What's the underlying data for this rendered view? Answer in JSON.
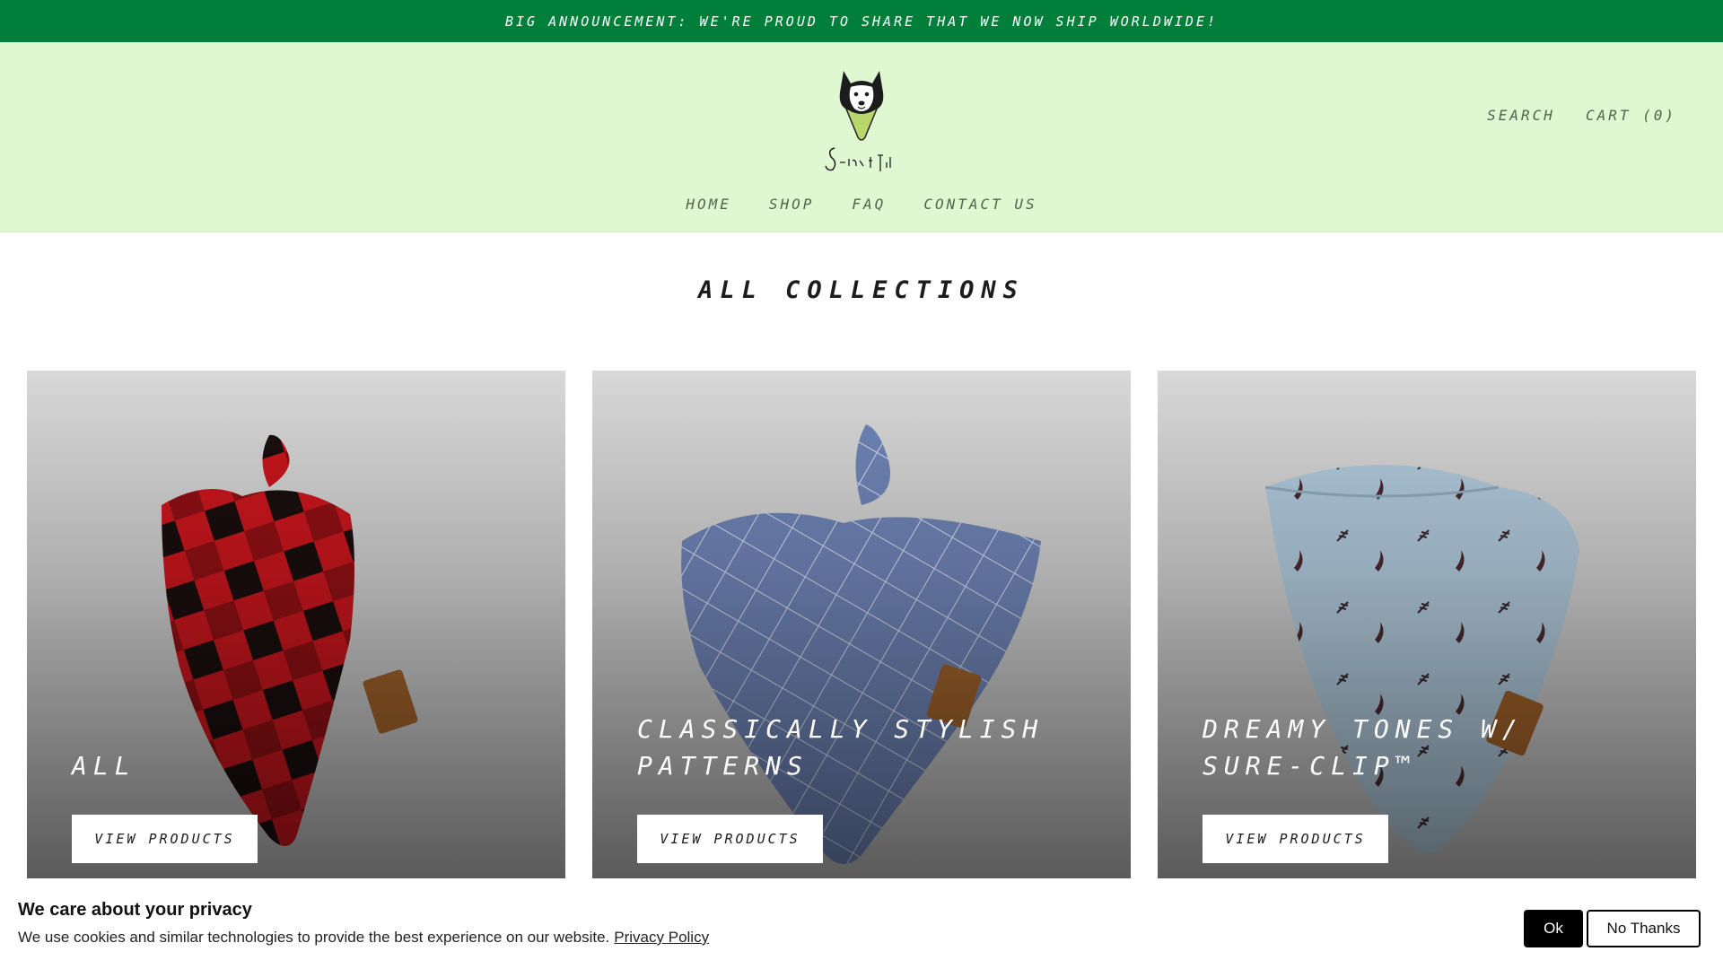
{
  "announcement": {
    "text": "Big announcement: We're proud to share that we now ship worldwide!"
  },
  "header": {
    "logo_text": "Scarf + Tail",
    "search_label": "Search",
    "cart_label": "Cart (0)"
  },
  "nav": {
    "items": [
      {
        "label": "Home"
      },
      {
        "label": "Shop"
      },
      {
        "label": "FAQ"
      },
      {
        "label": "Contact Us"
      }
    ]
  },
  "page": {
    "title": "All Collections"
  },
  "collections": [
    {
      "title": "All",
      "button_label": "View products"
    },
    {
      "title": "Classically Stylish Patterns",
      "button_label": "View products"
    },
    {
      "title": "Dreamy Tones w/ Sure-Clip™",
      "button_label": "View products"
    }
  ],
  "cookie_banner": {
    "title": "We care about your privacy",
    "text": "We use cookies and similar technologies to provide the best experience on our website.",
    "link_label": "Privacy Policy",
    "ok_label": "Ok",
    "decline_label": "No Thanks"
  },
  "colors": {
    "announcement_bg": "#017f3a",
    "header_bg": "#dff8d2",
    "nav_text": "#54634f"
  }
}
